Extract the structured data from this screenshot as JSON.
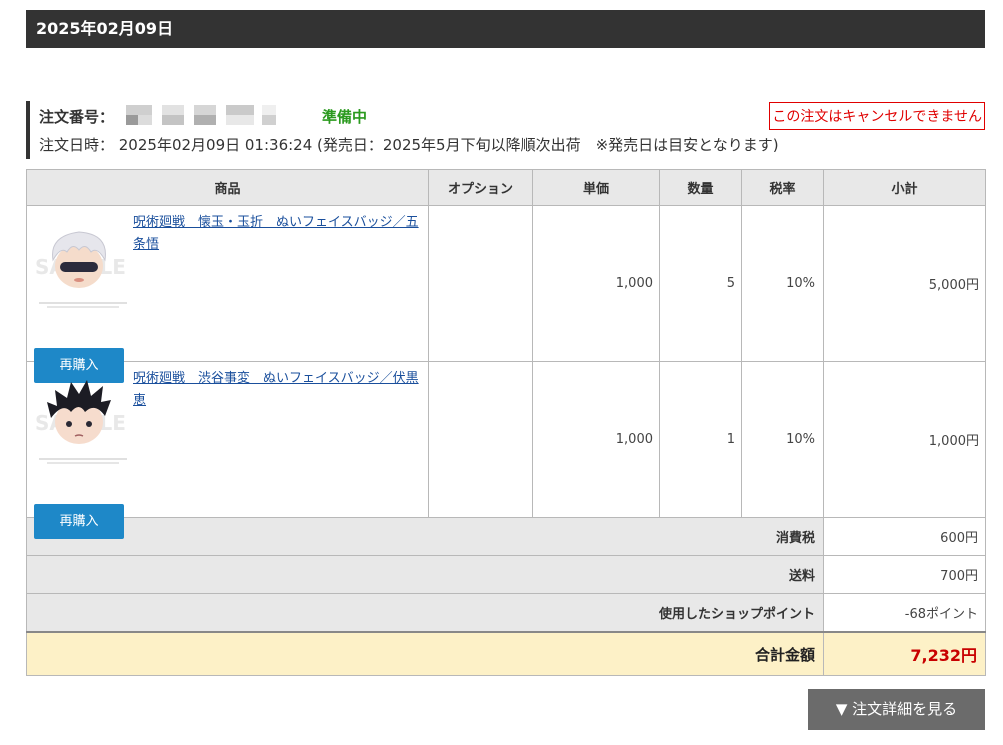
{
  "header": {
    "date": "2025年02月09日"
  },
  "order": {
    "number_label": "注文番号：",
    "status": "準備中",
    "date_line": "注文日時： 2025年02月09日 01:36:24 (発売日：2025年5月下旬以降順次出荷　※発売日は目安となります)",
    "cancel_notice": "この注文はキャンセルできません",
    "status_color": "#2b9a1f"
  },
  "table": {
    "headers": [
      "商品",
      "オプション",
      "単価",
      "数量",
      "税率",
      "小計"
    ],
    "items": [
      {
        "name": "呪術廻戦　懐玉・玉折　ぬいフェイスバッジ／五条悟",
        "option": "",
        "unit_price": "1,000",
        "quantity": "5",
        "tax_rate": "10%",
        "subtotal": "5,000円",
        "rebuy_label": "再購入",
        "thumb_icon": "gojo-plush-badge-icon"
      },
      {
        "name": "呪術廻戦　渋谷事変　ぬいフェイスバッジ／伏黒恵",
        "option": "",
        "unit_price": "1,000",
        "quantity": "1",
        "tax_rate": "10%",
        "subtotal": "1,000円",
        "rebuy_label": "再購入",
        "thumb_icon": "fushiguro-plush-badge-icon"
      }
    ],
    "summary": [
      {
        "label": "消費税",
        "value": "600円"
      },
      {
        "label": "送料",
        "value": "700円"
      },
      {
        "label": "使用したショップポイント",
        "value": "-68ポイント"
      }
    ],
    "total_label": "合計金額",
    "total_value": "7,232円"
  },
  "actions": {
    "detail_button": "▼ 注文詳細を見る"
  },
  "colors": {
    "accent_blue": "#1e88c8",
    "total_red": "#c80000",
    "total_bg": "#fdf1c7"
  }
}
